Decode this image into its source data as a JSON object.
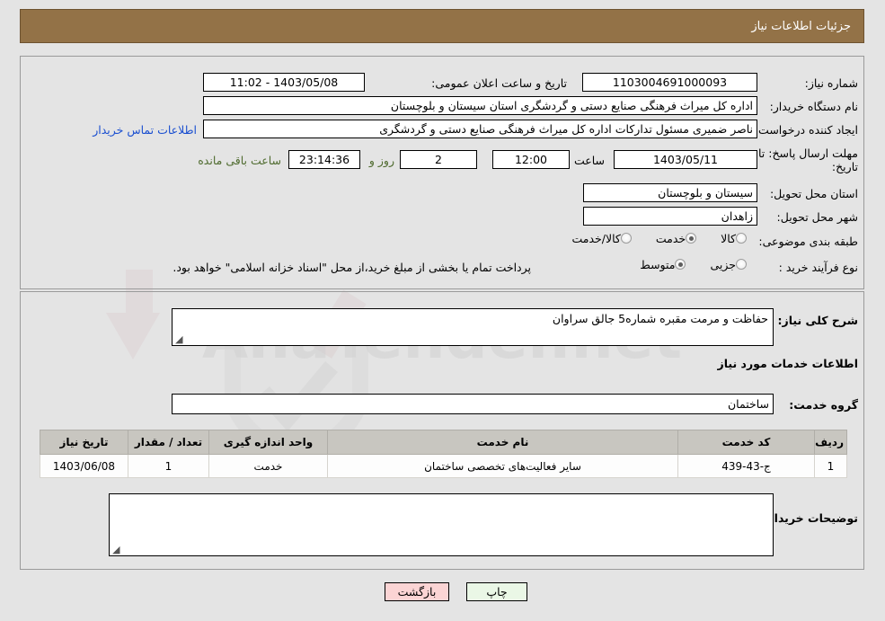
{
  "header": {
    "title": "جزئیات اطلاعات نیاز"
  },
  "top_form": {
    "need_number_label": "شماره نیاز:",
    "need_number_value": "1103004691000093",
    "announce_label": "تاریخ و ساعت اعلان عمومی:",
    "announce_value": "1403/05/08 - 11:02",
    "buyer_org_label": "نام دستگاه خریدار:",
    "buyer_org_value": "اداره کل میراث فرهنگی  صنایع دستی و گردشگری استان سیستان و بلوچستان",
    "creator_label": "ایجاد کننده درخواست:",
    "creator_value": "ناصر ضمیری مسئول تدارکات اداره کل میراث فرهنگی  صنایع دستی و گردشگری",
    "contact_link": "اطلاعات تماس خریدار",
    "deadline_label_line1": "مهلت ارسال پاسخ: تا",
    "deadline_label_line2": "تاریخ:",
    "deadline_date": "1403/05/11",
    "deadline_hour_label": "ساعت",
    "deadline_hour": "12:00",
    "remaining_days": "2",
    "remaining_days_label": "روز و",
    "remaining_time": "23:14:36",
    "remaining_time_label": "ساعت باقی مانده",
    "province_label": "استان محل تحویل:",
    "province_value": "سیستان و بلوچستان",
    "city_label": "شهر محل تحویل:",
    "city_value": "زاهدان",
    "category_label": "طبقه بندی موضوعی:",
    "category_options": [
      {
        "label": "کالا",
        "selected": false
      },
      {
        "label": "خدمت",
        "selected": true
      },
      {
        "label": "کالا/خدمت",
        "selected": false
      }
    ],
    "process_label": "نوع فرآیند خرید :",
    "process_options": [
      {
        "label": "جزیی",
        "selected": false
      },
      {
        "label": "متوسط",
        "selected": true
      }
    ],
    "payment_note": "پرداخت تمام یا بخشی از مبلغ خرید،از محل \"اسناد خزانه اسلامی\" خواهد بود."
  },
  "bottom": {
    "general_desc_label": "شرح کلی نیاز:",
    "general_desc_value": "حفاظت و مرمت مقبره شماره5 جالق سراوان",
    "services_info_title": "اطلاعات خدمات مورد نیاز",
    "service_group_label": "گروه خدمت:",
    "service_group_value": "ساختمان",
    "buyer_comments_label": "توضیحات خریدار:",
    "buyer_comments_value": ""
  },
  "items_table": {
    "columns": [
      "ردیف",
      "کد خدمت",
      "نام خدمت",
      "واحد اندازه گیری",
      "تعداد / مقدار",
      "تاریخ نیاز"
    ],
    "rows": [
      {
        "row": "1",
        "code": "ج-43-439",
        "name": "سایر فعالیت‌های تخصصی ساختمان",
        "unit": "خدمت",
        "qty": "1",
        "date": "1403/06/08"
      }
    ]
  },
  "footer": {
    "print_label": "چاپ",
    "back_label": "بازگشت"
  },
  "watermark": {
    "text": "AnaTender.net"
  },
  "colors": {
    "header_bg": "#937247",
    "link": "#1a4fd0",
    "countdown": "#4f6b2f",
    "print_btn": "#eaf7e6",
    "back_btn": "#fbd4d4",
    "table_header": "#c8c6c0"
  }
}
